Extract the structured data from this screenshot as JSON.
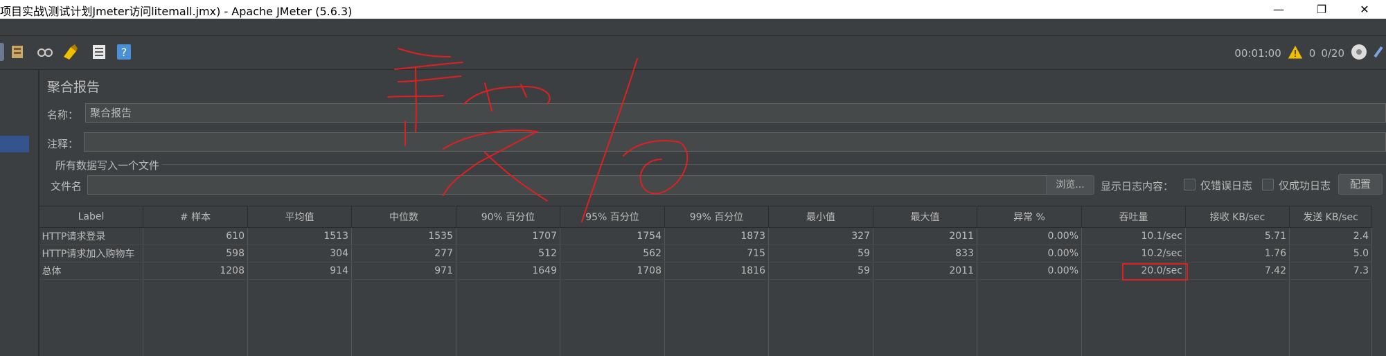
{
  "window": {
    "title": "项目实战\\测试计划Jmeter访问litemall.jmx) - Apache JMeter (5.6.3)",
    "minimize": "—",
    "maximize": "❐",
    "close": "✕"
  },
  "status": {
    "elapsed": "00:01:00",
    "warnings": "0",
    "threads": "0/20"
  },
  "panel": {
    "title": "聚合报告",
    "name_label": "名称：",
    "name_value": "聚合报告",
    "comment_label": "注释：",
    "comment_value": "",
    "group_title": "所有数据写入一个文件",
    "filename_label": "文件名",
    "filename_value": "",
    "browse": "浏览...",
    "log_label": "显示日志内容：",
    "errors_only": "仅错误日志",
    "success_only": "仅成功日志",
    "configure": "配置"
  },
  "table": {
    "headers": [
      "Label",
      "# 样本",
      "平均值",
      "中位数",
      "90% 百分位",
      "95% 百分位",
      "99% 百分位",
      "最小值",
      "最大值",
      "异常 %",
      "吞吐量",
      "接收 KB/sec",
      "发送 KB/sec"
    ],
    "rows": [
      [
        "HTTP请求登录",
        "610",
        "1513",
        "1535",
        "1707",
        "1754",
        "1873",
        "327",
        "2011",
        "0.00%",
        "10.1/sec",
        "5.71",
        "2.4"
      ],
      [
        "HTTP请求加入购物车",
        "598",
        "304",
        "277",
        "512",
        "562",
        "715",
        "59",
        "833",
        "0.00%",
        "10.2/sec",
        "1.76",
        "5.0"
      ],
      [
        "总体",
        "1208",
        "914",
        "971",
        "1649",
        "1708",
        "1816",
        "59",
        "2011",
        "0.00%",
        "20.0/sec",
        "7.42",
        "7.3"
      ]
    ]
  },
  "annotation": {
    "handwriting": "发后",
    "color": "#e02020"
  },
  "colors": {
    "background": "#3c3f41",
    "text": "#bbbbbb",
    "field": "#45494a"
  }
}
